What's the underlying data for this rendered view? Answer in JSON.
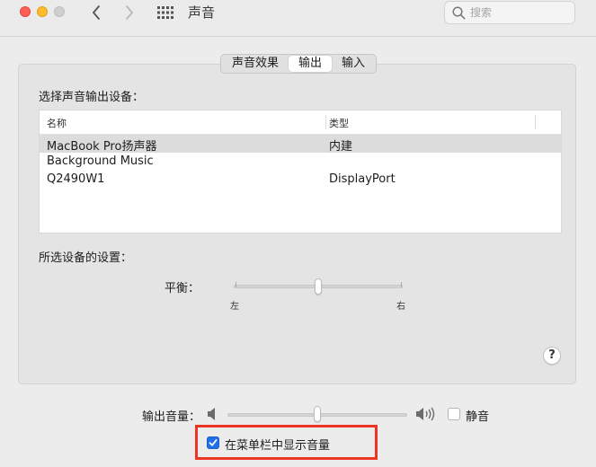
{
  "window": {
    "title": "声音",
    "search_placeholder": "搜索"
  },
  "tabs": [
    {
      "label": "声音效果",
      "selected": false
    },
    {
      "label": "输出",
      "selected": true
    },
    {
      "label": "输入",
      "selected": false
    }
  ],
  "output": {
    "select_device_label": "选择声音输出设备：",
    "columns": {
      "name": "名称",
      "type": "类型"
    },
    "devices": [
      {
        "name": "MacBook Pro扬声器",
        "type": "内建",
        "selected": true
      },
      {
        "name": "Background Music",
        "type": "",
        "selected": false
      },
      {
        "name": "Q2490W1",
        "type": "DisplayPort",
        "selected": false
      }
    ],
    "selected_device_settings_label": "所选设备的设置：",
    "balance": {
      "label": "平衡：",
      "left_label": "左",
      "right_label": "右",
      "value": 0.5
    }
  },
  "help_label": "?",
  "volume": {
    "label": "输出音量：",
    "value": 0.5,
    "mute_label": "静音",
    "mute_checked": false
  },
  "menubar_volume": {
    "label": "在菜单栏中显示音量",
    "checked": true
  },
  "colors": {
    "accent": "#1f6fe5",
    "highlight": "#ee3524",
    "close": "#ff5f57",
    "minimize": "#febc2e"
  },
  "icons": {
    "back": "chevron-left-icon",
    "forward": "chevron-right-icon",
    "show_all": "grid-icon",
    "search": "search-icon",
    "speaker_low": "speaker-low-icon",
    "speaker_high": "speaker-high-icon",
    "check": "checkmark-icon"
  }
}
